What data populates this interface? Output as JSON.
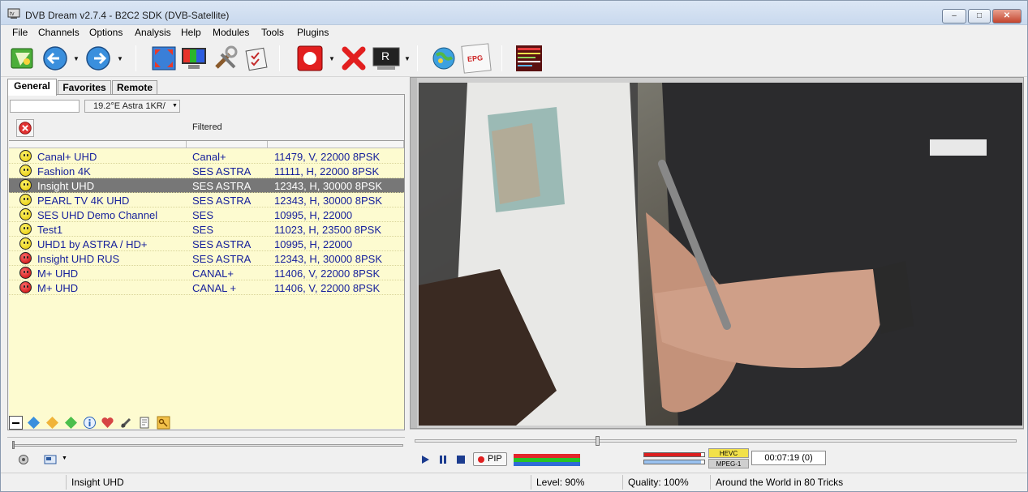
{
  "window": {
    "title": "DVB Dream v2.7.4 - B2C2 SDK (DVB-Satellite)",
    "controls": {
      "minimize": "–",
      "maximize": "□",
      "close": "✕"
    }
  },
  "menu": [
    "File",
    "Channels",
    "Options",
    "Analysis",
    "Help",
    "Modules",
    "Tools",
    "Plugins"
  ],
  "toolbar": {
    "icons": [
      "channel-list-icon",
      "back-icon",
      "forward-icon",
      "fullscreen-icon",
      "tv-icon",
      "settings-tools-icon",
      "checklist-icon",
      "record-icon",
      "stop-icon",
      "recorder-icon",
      "globe-icon",
      "epg-icon",
      "teletext-icon"
    ],
    "epg_label": "EPG",
    "recorder_letter": "R"
  },
  "tabs": [
    "General",
    "Favorites",
    "Remote"
  ],
  "filter": {
    "search_value": "",
    "satellite": "19.2°E Astra 1KR/",
    "filtered_label": "Filtered"
  },
  "channels": [
    {
      "name": "Canal+ UHD",
      "provider": "Canal+",
      "tp": "11479, V, 22000 8PSK",
      "status": "happy",
      "selected": false
    },
    {
      "name": "Fashion 4K",
      "provider": "SES ASTRA",
      "tp": "11111, H, 22000 8PSK",
      "status": "happy",
      "selected": false
    },
    {
      "name": "Insight UHD",
      "provider": "SES ASTRA",
      "tp": "12343, H, 30000 8PSK",
      "status": "happy",
      "selected": true
    },
    {
      "name": "PEARL TV 4K UHD",
      "provider": "SES ASTRA",
      "tp": "12343, H, 30000 8PSK",
      "status": "happy",
      "selected": false
    },
    {
      "name": "SES UHD Demo Channel",
      "provider": "SES",
      "tp": "10995, H, 22000",
      "status": "happy",
      "selected": false
    },
    {
      "name": "Test1",
      "provider": "SES",
      "tp": "11023, H, 23500 8PSK",
      "status": "happy",
      "selected": false
    },
    {
      "name": "UHD1 by ASTRA / HD+",
      "provider": "SES ASTRA",
      "tp": "10995, H, 22000",
      "status": "happy",
      "selected": false
    },
    {
      "name": "Insight UHD RUS",
      "provider": "SES ASTRA",
      "tp": "12343, H, 30000 8PSK",
      "status": "sad",
      "selected": false
    },
    {
      "name": "M+ UHD",
      "provider": "CANAL+",
      "tp": "11406, V, 22000 8PSK",
      "status": "sad",
      "selected": false
    },
    {
      "name": "M+ UHD",
      "provider": "CANAL +",
      "tp": "11406, V, 22000 8PSK",
      "status": "sad",
      "selected": false
    }
  ],
  "player": {
    "pip_label": "PIP",
    "codec_top": "HEVC",
    "codec_bottom": "MPEG-1",
    "time": "00:07:19  (0)",
    "seek_fraction": 0.3
  },
  "status": {
    "channel": "Insight UHD",
    "level": "Level: 90%",
    "quality": "Quality: 100%",
    "program": "Around the World in 80 Tricks"
  },
  "colors": {
    "list_bg": "#fdfbd0",
    "channel_text": "#151f9b",
    "selected_bg": "#777777"
  }
}
